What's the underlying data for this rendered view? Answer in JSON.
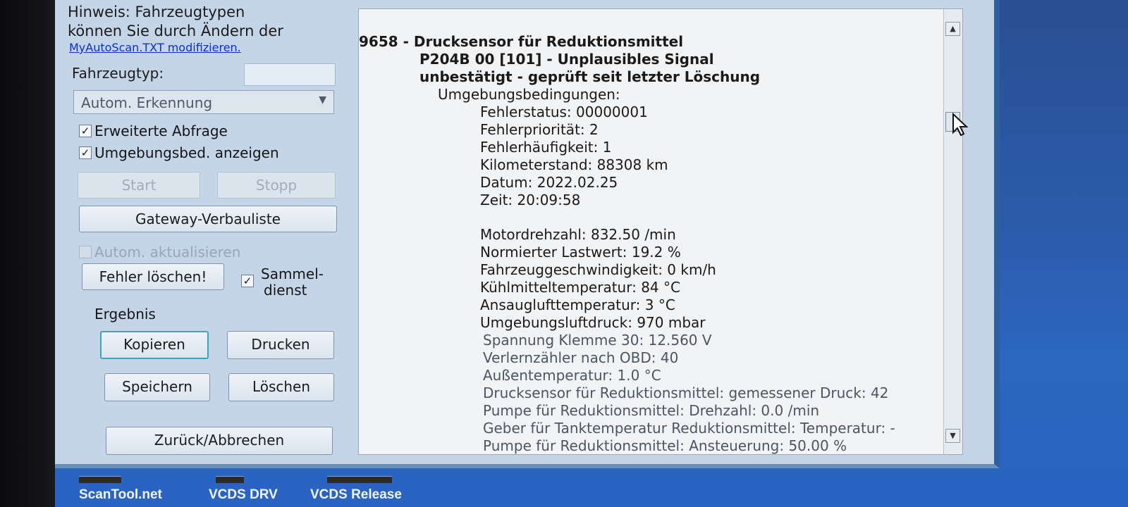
{
  "left_panel": {
    "hint_line1": "Hinweis: Fahrzeugtypen",
    "hint_line2": "können Sie durch Ändern der",
    "hint_link": "MyAutoScan.TXT modifizieren.",
    "vehicle_type_label": "Fahrzeugtyp:",
    "vehicle_type_value": "",
    "dropdown_value": "Autom. Erkennung",
    "extended_query_label": "Erweiterte Abfrage",
    "extended_query_checked": "✓",
    "show_env_label": "Umgebungsbed. anzeigen",
    "show_env_checked": "✓",
    "start_label": "Start",
    "stop_label": "Stopp",
    "gateway_label": "Gateway-Verbauliste",
    "auto_update_label": "Autom. aktualisieren",
    "clear_faults_label": "Fehler löschen!",
    "collective_checked": "✓",
    "collective_label_line1": "Sammel-",
    "collective_label_line2": "dienst",
    "result_label": "Ergebnis",
    "copy_label": "Kopieren",
    "print_label": "Drucken",
    "save_label": "Speichern",
    "delete_label": "Löschen",
    "back_label": "Zurück/Abbrechen"
  },
  "fault_log": {
    "lines": [
      "9658 - Drucksensor für Reduktionsmittel",
      "P204B 00 [101] - Unplausibles Signal",
      "unbestätigt - geprüft seit letzter Löschung",
      "Umgebungsbedingungen:",
      "Fehlerstatus: 00000001",
      "Fehlerpriorität: 2",
      "Fehlerhäufigkeit: 1",
      "Kilometerstand: 88308 km",
      "Datum: 2022.02.25",
      "Zeit: 20:09:58",
      "Motordrehzahl: 832.50 /min",
      "Normierter Lastwert: 19.2 %",
      "Fahrzeuggeschwindigkeit: 0 km/h",
      "Kühlmitteltemperatur: 84 °C",
      "Ansauglufttemperatur: 3 °C",
      "Umgebungsluftdruck: 970 mbar",
      "Spannung Klemme 30: 12.560 V",
      "Verlernzähler nach OBD: 40",
      "Außentemperatur: 1.0 °C",
      "Drucksensor für Reduktionsmittel: gemessener Druck: 42",
      "Pumpe für Reduktionsmittel: Drehzahl: 0.0 /min",
      "Geber für Tanktemperatur Reduktionsmittel: Temperatur: -",
      "Pumpe für Reduktionsmittel: Ansteuerung: 50.00 %"
    ]
  },
  "taskbar": {
    "items": [
      "ScanTool.net",
      "VCDS DRV",
      "VCDS Release"
    ]
  },
  "colors": {
    "window_bg": "#c4d5e8",
    "text_pane_bg": "#f1f3f5",
    "link": "#0a2fd1",
    "desktop": "#2b5aa8"
  }
}
